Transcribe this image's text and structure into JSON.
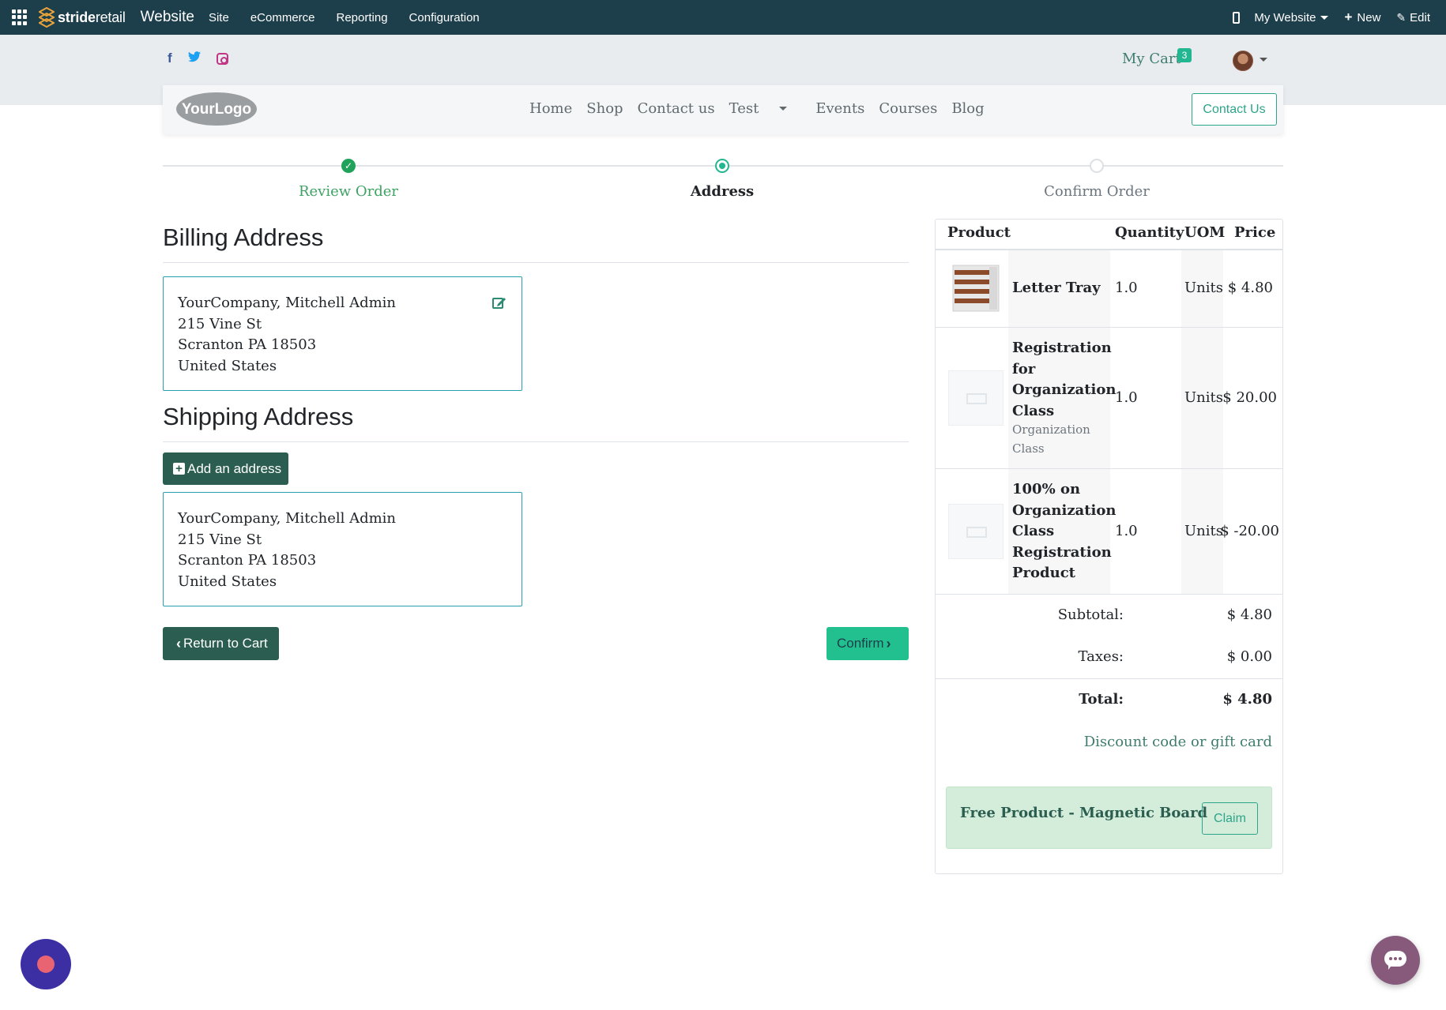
{
  "adminbar": {
    "brand_prefix": "stride",
    "brand_suffix": "retail",
    "app_title": "Website",
    "menu": [
      "Site",
      "eCommerce",
      "Reporting",
      "Configuration"
    ],
    "website_switcher": "My Website",
    "new_label": "New",
    "edit_label": "Edit"
  },
  "header": {
    "cart_label": "My Cart",
    "cart_count": "3",
    "logo_text": "YourLogo",
    "nav": [
      "Home",
      "Shop",
      "Contact us",
      "Test",
      "Events",
      "Courses",
      "Blog"
    ],
    "contact_button": "Contact Us",
    "social_icons": [
      "facebook-icon",
      "twitter-icon",
      "instagram-icon"
    ]
  },
  "steps": [
    {
      "label": "Review Order",
      "state": "done"
    },
    {
      "label": "Address",
      "state": "current"
    },
    {
      "label": "Confirm Order",
      "state": "todo"
    }
  ],
  "billing": {
    "title": "Billing Address",
    "lines": [
      "YourCompany, Mitchell Admin",
      "215 Vine St",
      "Scranton PA 18503",
      "United States"
    ]
  },
  "shipping": {
    "title": "Shipping Address",
    "add_button": "Add an address",
    "lines": [
      "YourCompany, Mitchell Admin",
      "215 Vine St",
      "Scranton PA 18503",
      "United States"
    ]
  },
  "actions": {
    "return_label": "Return to Cart",
    "confirm_label": "Confirm"
  },
  "summary": {
    "headers": {
      "product": "Product",
      "quantity": "Quantity",
      "uom": "UOM",
      "price": "Price"
    },
    "rows": [
      {
        "name_lines": [
          "Letter Tray"
        ],
        "sub_lines": [],
        "quantity": "1.0",
        "uom": "Units",
        "price": "$ 4.80"
      },
      {
        "name_lines": [
          "Registration",
          "for",
          "Organization",
          "Class"
        ],
        "sub_lines": [
          "Organization",
          "Class"
        ],
        "quantity": "1.0",
        "uom": "Units",
        "price": "$ 20.00"
      },
      {
        "name_lines": [
          "100% on",
          "Organization",
          "Class",
          "Registration",
          "Product"
        ],
        "sub_lines": [],
        "quantity": "1.0",
        "uom": "Units",
        "price": "$ -20.00"
      }
    ],
    "subtotal_label": "Subtotal:",
    "subtotal": "$ 4.80",
    "taxes_label": "Taxes:",
    "taxes": "$ 0.00",
    "total_label": "Total:",
    "total": "$ 4.80",
    "discount_link": "Discount code or gift card",
    "promo_title": "Free Product - Magnetic Board",
    "claim_label": "Claim"
  },
  "colors": {
    "admin_bar": "#1d3e4b",
    "accent": "#22b691",
    "primary_dark": "#2b5e50",
    "promo_bg": "#d4edda"
  }
}
